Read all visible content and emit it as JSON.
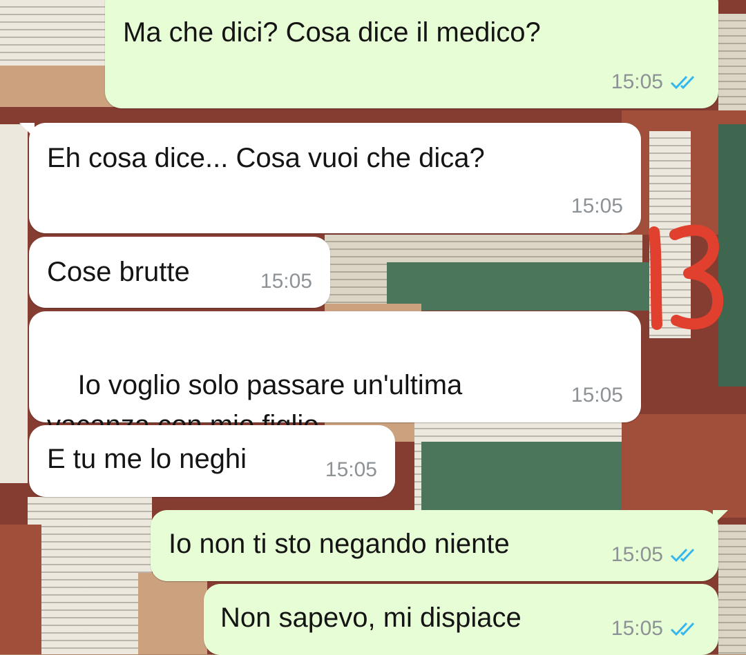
{
  "chat": {
    "messages": [
      {
        "direction": "outgoing",
        "text": "Ma che dici? Cosa dice il medico?",
        "time": "15:05",
        "status": "read"
      },
      {
        "direction": "incoming",
        "text": "Eh cosa dice... Cosa vuoi che dica?",
        "time": "15:05"
      },
      {
        "direction": "incoming",
        "text": "Cose brutte",
        "time": "15:05"
      },
      {
        "direction": "incoming",
        "text": "Io voglio solo passare un'ultima vacanza con mio figlio",
        "time": "15:05"
      },
      {
        "direction": "incoming",
        "text": "E tu me lo neghi",
        "time": "15:05"
      },
      {
        "direction": "outgoing",
        "text": "Io non ti sto negando niente",
        "time": "15:05",
        "status": "read"
      },
      {
        "direction": "outgoing",
        "text": "Non sapevo, mi dispiace",
        "time": "15:05",
        "status": "read"
      }
    ]
  },
  "annotation": {
    "text": "13",
    "color": "#e1402e"
  },
  "colors": {
    "incoming_bubble": "#ffffff",
    "outgoing_bubble": "#e7fdd5",
    "read_tick": "#34b7f1",
    "timestamp": "#8c9296"
  },
  "icons": {
    "read_receipt": "double-check-icon"
  }
}
